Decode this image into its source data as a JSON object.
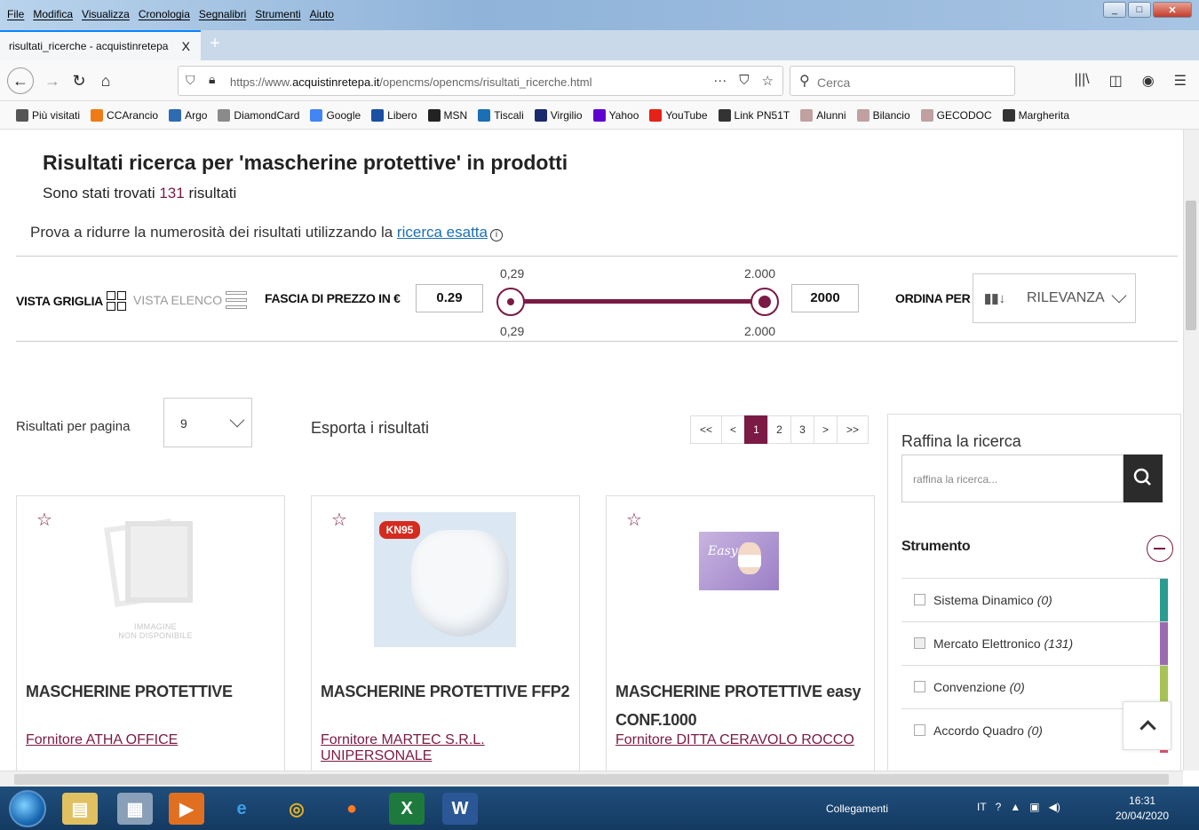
{
  "menu": [
    "File",
    "Modifica",
    "Visualizza",
    "Cronologia",
    "Segnalibri",
    "Strumenti",
    "Aiuto"
  ],
  "tab": {
    "title": "risultati_ricerche - acquistinretepa",
    "close": "X",
    "new": "+"
  },
  "url": {
    "prefix": "https://www.",
    "domain": "acquistinretepa.it",
    "path": "/opencms/opencms/risultati_ricerche.html"
  },
  "search": {
    "placeholder": "Cerca"
  },
  "bookmarks": [
    {
      "label": "Più visitati",
      "color": "#555555",
      "icon": "gear-icon"
    },
    {
      "label": "CCArancio",
      "color": "#f07b16",
      "icon": "ccarancio-icon"
    },
    {
      "label": "Argo",
      "color": "#2f6bb3",
      "icon": "argo-icon"
    },
    {
      "label": "DiamondCard",
      "color": "#8a8a8a",
      "icon": "diamond-icon"
    },
    {
      "label": "Google",
      "color": "#4285f4",
      "icon": "google-icon"
    },
    {
      "label": "Libero",
      "color": "#1a4fa3",
      "icon": "libero-icon"
    },
    {
      "label": "MSN",
      "color": "#222222",
      "icon": "msn-icon"
    },
    {
      "label": "Tiscali",
      "color": "#1b6fb5",
      "icon": "tiscali-icon"
    },
    {
      "label": "Virgilio",
      "color": "#1a2a6c",
      "icon": "virgilio-icon"
    },
    {
      "label": "Yahoo",
      "color": "#5f01d1",
      "icon": "yahoo-icon"
    },
    {
      "label": "YouTube",
      "color": "#e62117",
      "icon": "youtube-icon"
    },
    {
      "label": "Link PN51T",
      "color": "#333333",
      "icon": "globe-icon"
    },
    {
      "label": "Alunni",
      "color": "#c0a0a0",
      "icon": "folder-icon"
    },
    {
      "label": "Bilancio",
      "color": "#c0a0a0",
      "icon": "folder-icon"
    },
    {
      "label": "GECODOC",
      "color": "#c0a0a0",
      "icon": "folder-icon"
    },
    {
      "label": "Margherita",
      "color": "#333333",
      "icon": "globe-icon"
    }
  ],
  "page": {
    "heading": "Risultati ricerca per 'mascherine protettive' in prodotti",
    "count_prefix": "Sono stati trovati ",
    "count_value": "131",
    "count_suffix": " risultati",
    "hint_text": "Prova a ridurre la numerosità dei risultati utilizzando la ",
    "hint_link": "ricerca esatta"
  },
  "controls": {
    "vista_griglia": "VISTA GRIGLIA",
    "vista_elenco": "VISTA ELENCO",
    "fascia": "FASCIA DI PREZZO IN €",
    "min_value": "0.29",
    "max_value": "2000",
    "min_label_top": "0,29",
    "max_label_top": "2.000",
    "min_label_bottom": "0,29",
    "max_label_bottom": "2.000",
    "ordina": "ORDINA PER",
    "sort_value": "RILEVANZA"
  },
  "results": {
    "per_page_label": "Risultati per pagina",
    "per_page_value": "9",
    "export": "Esporta i risultati",
    "pager": [
      "<<",
      "<",
      "1",
      "2",
      "3",
      ">",
      ">>"
    ]
  },
  "cards": [
    {
      "title": "MASCHERINE PROTETTIVE",
      "supplier": "Fornitore ATHA OFFICE",
      "image_caption_1": "IMMAGINE",
      "image_caption_2": "NON DISPONIBILE"
    },
    {
      "title": "MASCHERINE PROTETTIVE FFP2",
      "supplier": "Fornitore MARTEC S.R.L. UNIPERSONALE",
      "badge": "KN95"
    },
    {
      "title_line1": "MASCHERINE PROTETTIVE easy",
      "title_line2": "CONF.1000",
      "supplier": "Fornitore DITTA CERAVOLO ROCCO",
      "brand": "Easy"
    }
  ],
  "sidebar": {
    "title": "Raffina la ricerca",
    "placeholder": "raffina la ricerca...",
    "section": "Strumento",
    "filters": [
      {
        "label": "Sistema Dinamico",
        "count": "(0)",
        "color": "#2a9d8f"
      },
      {
        "label": "Mercato Elettronico",
        "count": "(131)",
        "color": "#9b6bb0"
      },
      {
        "label": "Convenzione",
        "count": "(0)",
        "color": "#a8c256"
      },
      {
        "label": "Accordo Quadro",
        "count": "(0)",
        "color": "#d9536f"
      }
    ]
  },
  "taskbar": {
    "collegamenti": "Collegamenti",
    "lang": "IT",
    "time": "16:31",
    "date": "20/04/2020"
  },
  "accent": "#7a1a45"
}
